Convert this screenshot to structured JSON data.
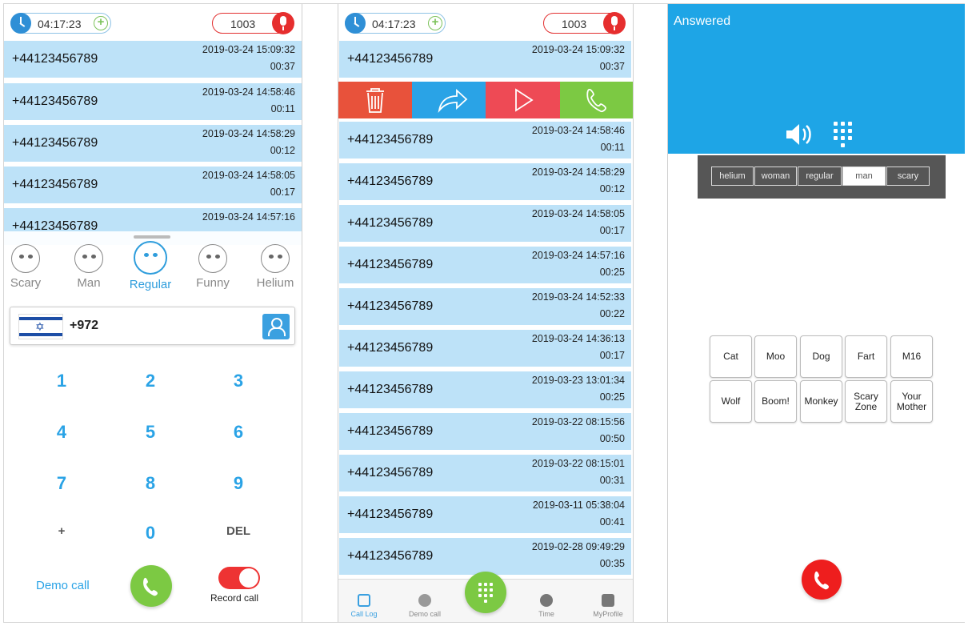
{
  "header": {
    "time": "04:17:23",
    "credits": "1003"
  },
  "panel1": {
    "rows": [
      {
        "number": "+44123456789",
        "datetime": "2019-03-24 15:09:32",
        "duration": "00:37"
      },
      {
        "number": "+44123456789",
        "datetime": "2019-03-24 14:58:46",
        "duration": "00:11"
      },
      {
        "number": "+44123456789",
        "datetime": "2019-03-24 14:58:29",
        "duration": "00:12"
      },
      {
        "number": "+44123456789",
        "datetime": "2019-03-24 14:58:05",
        "duration": "00:17"
      },
      {
        "number": "+44123456789",
        "datetime": "2019-03-24 14:57:16",
        "duration": ""
      }
    ],
    "voices": [
      {
        "label": "Scary"
      },
      {
        "label": "Man"
      },
      {
        "label": "Regular"
      },
      {
        "label": "Funny"
      },
      {
        "label": "Helium"
      }
    ],
    "country_code": "+972",
    "keys": [
      "1",
      "2",
      "3",
      "4",
      "5",
      "6",
      "7",
      "8",
      "9",
      "+",
      "0",
      "DEL"
    ],
    "demo_call": "Demo call",
    "record_call": "Record call"
  },
  "panel2": {
    "rows": [
      {
        "number": "+44123456789",
        "datetime": "2019-03-24 15:09:32",
        "duration": "00:37"
      },
      {
        "number": "+44123456789",
        "datetime": "2019-03-24 14:58:46",
        "duration": "00:11"
      },
      {
        "number": "+44123456789",
        "datetime": "2019-03-24 14:58:29",
        "duration": "00:12"
      },
      {
        "number": "+44123456789",
        "datetime": "2019-03-24 14:58:05",
        "duration": "00:17"
      },
      {
        "number": "+44123456789",
        "datetime": "2019-03-24 14:57:16",
        "duration": "00:25"
      },
      {
        "number": "+44123456789",
        "datetime": "2019-03-24 14:52:33",
        "duration": "00:22"
      },
      {
        "number": "+44123456789",
        "datetime": "2019-03-24 14:36:13",
        "duration": "00:17"
      },
      {
        "number": "+44123456789",
        "datetime": "2019-03-23 13:01:34",
        "duration": "00:25"
      },
      {
        "number": "+44123456789",
        "datetime": "2019-03-22 08:15:56",
        "duration": "00:50"
      },
      {
        "number": "+44123456789",
        "datetime": "2019-03-22 08:15:01",
        "duration": "00:31"
      },
      {
        "number": "+44123456789",
        "datetime": "2019-03-11 05:38:04",
        "duration": "00:41"
      },
      {
        "number": "+44123456789",
        "datetime": "2019-02-28 09:49:29",
        "duration": "00:35"
      }
    ],
    "actions": [
      "trash-icon",
      "share-icon",
      "play-icon",
      "phone-icon"
    ],
    "action_colors": [
      "#e8523b",
      "#2aa3e6",
      "#ee4a55",
      "#7cc943"
    ],
    "tabs": [
      "Call Log",
      "Demo call",
      "Time",
      "MyProfile"
    ]
  },
  "panel3": {
    "status": "Answered",
    "voice_buttons": [
      "helium",
      "woman",
      "regular",
      "man",
      "scary"
    ],
    "selected_voice": "man",
    "sounds": [
      "Cat",
      "Moo",
      "Dog",
      "Fart",
      "M16",
      "Wolf",
      "Boom!",
      "Monkey",
      "Scary Zone",
      "Your Mother"
    ]
  }
}
